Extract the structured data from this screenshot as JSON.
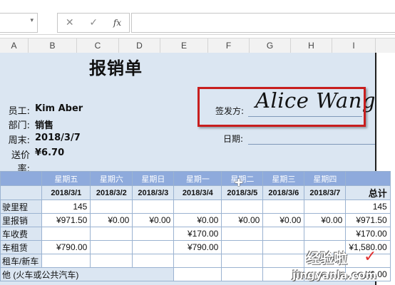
{
  "formula_bar": {
    "cancel_icon": "✕",
    "enter_icon": "✓",
    "fx_label": "fx",
    "dropdown_icon": "▾"
  },
  "columns": [
    "A",
    "B",
    "C",
    "D",
    "E",
    "F",
    "G",
    "H",
    "I"
  ],
  "sheet": {
    "title": "报销单",
    "info": [
      {
        "label": "员工:",
        "value": "Kim Aber"
      },
      {
        "label": "部门:",
        "value": "销售"
      },
      {
        "label": "周末:",
        "value": "2018/3/7"
      },
      {
        "label": "送价率:",
        "value": "¥6.70"
      }
    ],
    "sign_label": "签发方:",
    "signature": "Alice Wang",
    "date_label": "日期:"
  },
  "table": {
    "weekdays": [
      "",
      "星期五",
      "星期六",
      "星期日",
      "星期一",
      "星期二",
      "星期三",
      "星期四",
      ""
    ],
    "dates": [
      "",
      "2018/3/1",
      "2018/3/2",
      "2018/3/3",
      "2018/3/4",
      "2018/3/5",
      "2018/3/6",
      "2018/3/7",
      "总计"
    ],
    "rows": [
      [
        "驶里程",
        "145",
        "",
        "",
        "",
        "",
        "",
        "",
        "145"
      ],
      [
        "里报销",
        "¥971.50",
        "¥0.00",
        "¥0.00",
        "¥0.00",
        "¥0.00",
        "¥0.00",
        "¥0.00",
        "¥971.50"
      ],
      [
        "车收费",
        "",
        "",
        "",
        "¥170.00",
        "",
        "",
        "",
        "¥170.00"
      ],
      [
        "车租赁",
        "¥790.00",
        "",
        "",
        "¥790.00",
        "",
        "",
        "",
        "¥1,580.00"
      ],
      [
        "租车/新车",
        "",
        "",
        "",
        "",
        "",
        "",
        "",
        ""
      ],
      [
        "他 (火车或公共汽车)",
        "",
        "",
        "",
        "",
        "",
        "",
        "",
        "¥0.00"
      ]
    ]
  },
  "watermark": {
    "text": "经验啦",
    "check": "✓",
    "url": "jingyanla.com"
  },
  "colors": {
    "header_blue": "#8eaadc",
    "sheet_bg": "#dbe6f2",
    "highlight_red": "#c81e1e"
  }
}
